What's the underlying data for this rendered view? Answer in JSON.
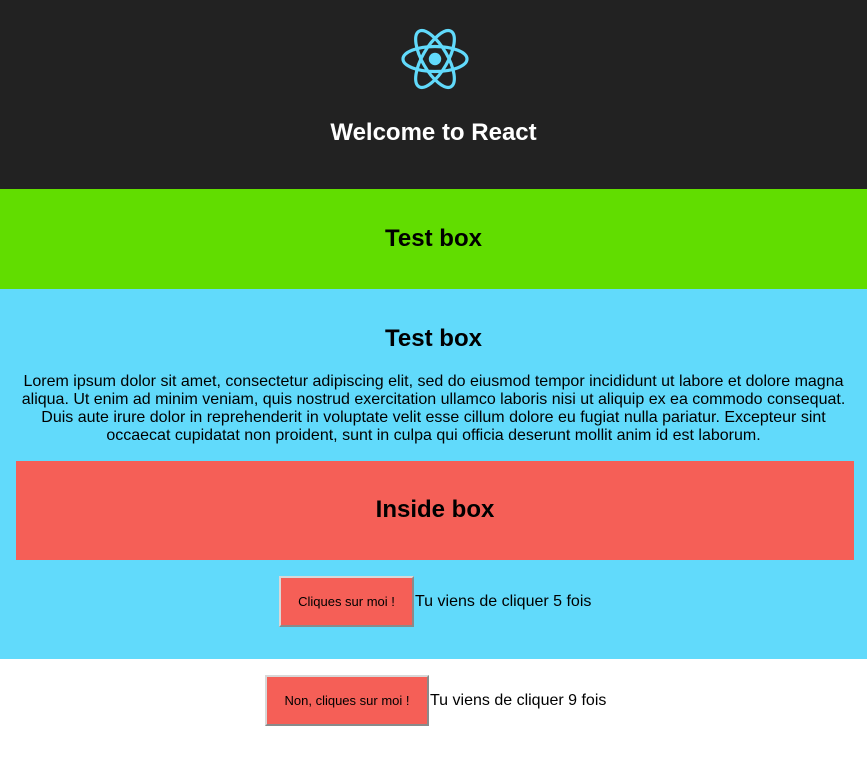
{
  "header": {
    "logo_icon": "react-atom-icon",
    "logo_color": "#61dafb",
    "title": "Welcome to React"
  },
  "green_box": {
    "title": "Test box",
    "color": "#61dd00"
  },
  "blue_box": {
    "title": "Test box",
    "color": "#61dafb",
    "text": "Lorem ipsum dolor sit amet, consectetur adipiscing elit, sed do eiusmod tempor incididunt ut labore et dolore magna aliqua. Ut enim ad minim veniam, quis nostrud exercitation ullamco laboris nisi ut aliquip ex ea commodo consequat. Duis aute irure dolor in reprehenderit in voluptate velit esse cillum dolore eu fugiat nulla pariatur. Excepteur sint occaecat cupidatat non proident, sunt in culpa qui officia deserunt mollit anim id est laborum.",
    "inside_box": {
      "title": "Inside box",
      "color": "#f55f57"
    },
    "counter": {
      "button_label": "Cliques sur moi !",
      "text": "Tu viens de cliquer 5 fois"
    }
  },
  "bottom_counter": {
    "button_label": "Non, cliques sur moi !",
    "text": "Tu viens de cliquer 9 fois"
  }
}
